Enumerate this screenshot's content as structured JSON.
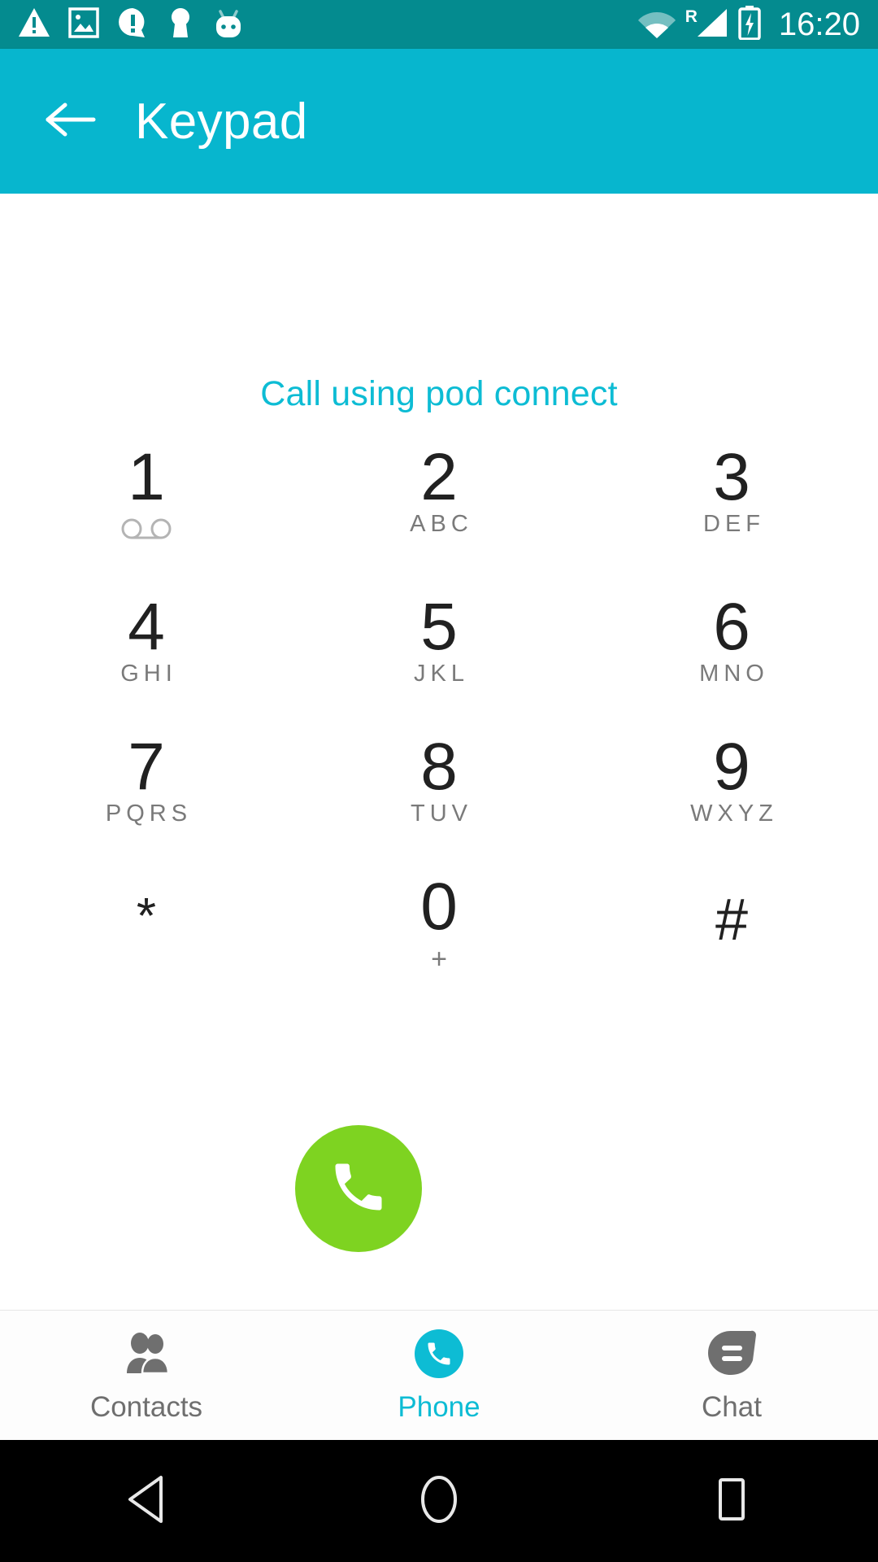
{
  "status_bar": {
    "background": "#048b8f",
    "icons": [
      {
        "name": "warning-triangle-icon"
      },
      {
        "name": "screenshot-image-icon"
      },
      {
        "name": "alert-bubble-icon"
      },
      {
        "name": "keyhole-icon"
      },
      {
        "name": "android-marshmallow-icon"
      }
    ],
    "wifi_icon": "wifi-icon",
    "roaming_label": "R",
    "signal_icon": "cellular-signal-icon",
    "battery_icon": "battery-charging-icon",
    "time": "16:20"
  },
  "app_bar": {
    "background": "#07b6ce",
    "back_icon": "back-arrow-icon",
    "title": "Keypad"
  },
  "keypad_screen": {
    "call_via_label": "Call using pod connect",
    "call_via_color": "#0dbcd4",
    "keys": [
      {
        "digit": "1",
        "sub": "",
        "icon": "voicemail-icon"
      },
      {
        "digit": "2",
        "sub": "ABC",
        "icon": ""
      },
      {
        "digit": "3",
        "sub": "DEF",
        "icon": ""
      },
      {
        "digit": "4",
        "sub": "GHI",
        "icon": ""
      },
      {
        "digit": "5",
        "sub": "JKL",
        "icon": ""
      },
      {
        "digit": "6",
        "sub": "MNO",
        "icon": ""
      },
      {
        "digit": "7",
        "sub": "PQRS",
        "icon": ""
      },
      {
        "digit": "8",
        "sub": "TUV",
        "icon": ""
      },
      {
        "digit": "9",
        "sub": "WXYZ",
        "icon": ""
      },
      {
        "digit": "*",
        "sub": "",
        "icon": ""
      },
      {
        "digit": "0",
        "sub": "+",
        "icon": ""
      },
      {
        "digit": "#",
        "sub": "",
        "icon": ""
      }
    ],
    "call_button": {
      "icon": "phone-handset-icon",
      "color": "#7ed321"
    }
  },
  "tab_bar": {
    "active_color": "#0dbcd4",
    "inactive_color": "#6f6f6f",
    "tabs": [
      {
        "label": "Contacts",
        "icon": "contacts-people-icon",
        "active": false
      },
      {
        "label": "Phone",
        "icon": "phone-circle-icon",
        "active": true
      },
      {
        "label": "Chat",
        "icon": "chat-bubble-icon",
        "active": false
      }
    ]
  },
  "nav_bar": {
    "back_icon": "nav-back-triangle-icon",
    "home_icon": "nav-home-circle-icon",
    "recents_icon": "nav-recents-square-icon"
  }
}
